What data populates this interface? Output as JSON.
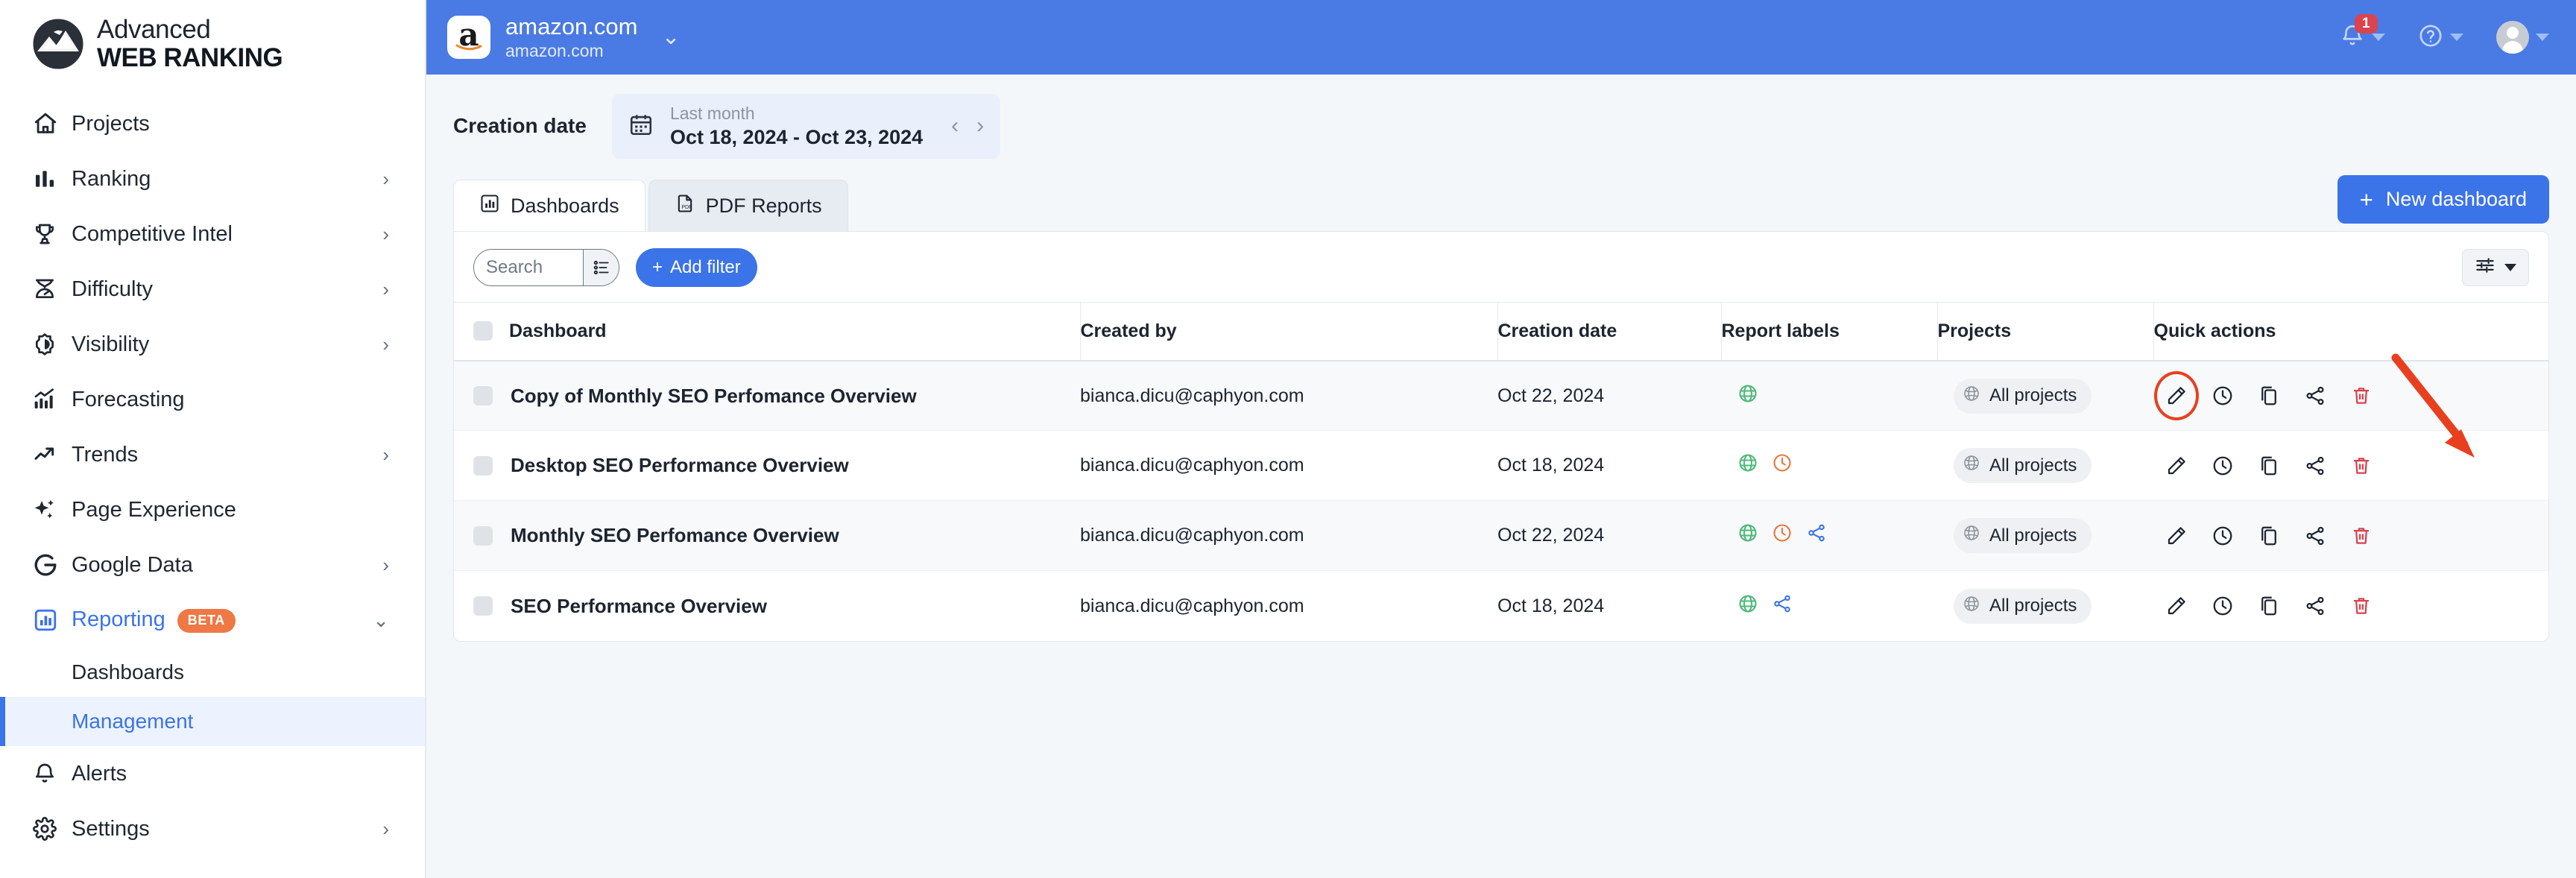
{
  "brand": {
    "line1": "Advanced",
    "line2": "WEB RANKING",
    "logo_icon": "globe-mountain-logo"
  },
  "sidebar": {
    "items": [
      {
        "label": "Projects",
        "icon": "home-icon",
        "chevron": "",
        "active": false
      },
      {
        "label": "Ranking",
        "icon": "bar-chart-icon",
        "chevron": "›",
        "active": false
      },
      {
        "label": "Competitive Intel",
        "icon": "trophy-icon",
        "chevron": "›",
        "active": false
      },
      {
        "label": "Difficulty",
        "icon": "hourglass-gauge-icon",
        "chevron": "›",
        "active": false
      },
      {
        "label": "Visibility",
        "icon": "brightness-icon",
        "chevron": "›",
        "active": false
      },
      {
        "label": "Forecasting",
        "icon": "forecast-chart-icon",
        "chevron": "",
        "active": false
      },
      {
        "label": "Trends",
        "icon": "trend-arrow-icon",
        "chevron": "›",
        "active": false
      },
      {
        "label": "Page Experience",
        "icon": "sparkles-icon",
        "chevron": "",
        "active": false
      },
      {
        "label": "Google Data",
        "icon": "google-g-icon",
        "chevron": "›",
        "active": false
      },
      {
        "label": "Reporting",
        "icon": "report-chart-icon",
        "chevron": "⌄",
        "active": true,
        "badge": "BETA"
      }
    ],
    "subitems": [
      {
        "label": "Dashboards",
        "selected": false
      },
      {
        "label": "Management",
        "selected": true
      }
    ],
    "tail": [
      {
        "label": "Alerts",
        "icon": "bell-icon",
        "chevron": ""
      },
      {
        "label": "Settings",
        "icon": "gear-icon",
        "chevron": "›"
      }
    ]
  },
  "topbar": {
    "site_name": "amazon.com",
    "site_domain": "amazon.com",
    "favicon_letter": "a",
    "chevron": "⌄",
    "notifications_count": "1",
    "notification_icon": "bell-icon",
    "help_icon": "question-circle-icon",
    "avatar_icon": "user-avatar-icon",
    "accent": "#4a7ae4"
  },
  "datebar": {
    "label": "Creation date",
    "preset": "Last month",
    "range": "Oct 18, 2024 - Oct 23, 2024",
    "calendar_icon": "calendar-icon",
    "prev": "‹",
    "next": "›"
  },
  "tabs": [
    {
      "label": "Dashboards",
      "icon": "bar-chart-icon",
      "active": true
    },
    {
      "label": "PDF Reports",
      "icon": "pdf-file-icon",
      "active": false
    }
  ],
  "actions": {
    "new_dashboard": "New dashboard",
    "new_dashboard_plus": "+",
    "add_filter": "Add filter",
    "add_filter_plus": "+",
    "settings_icon": "sliders-icon"
  },
  "search": {
    "value": "",
    "placeholder": "Search",
    "list_icon": "list-settings-icon"
  },
  "table": {
    "columns": [
      "Dashboard",
      "Created by",
      "Creation date",
      "Report labels",
      "Projects",
      "Quick actions"
    ],
    "rows": [
      {
        "name": "Copy of Monthly SEO Perfomance Overview",
        "created_by": "bianca.dicu@caphyon.com",
        "creation_date": "Oct 22, 2024",
        "labels": [
          "globe"
        ],
        "project": "All projects",
        "actions": [
          "edit",
          "schedule",
          "duplicate",
          "share",
          "delete"
        ],
        "highlighted_action": "edit"
      },
      {
        "name": "Desktop SEO Performance Overview",
        "created_by": "bianca.dicu@caphyon.com",
        "creation_date": "Oct 18, 2024",
        "labels": [
          "globe",
          "clock"
        ],
        "project": "All projects",
        "actions": [
          "edit",
          "schedule",
          "duplicate",
          "share",
          "delete"
        ],
        "highlighted_action": ""
      },
      {
        "name": "Monthly SEO Perfomance Overview",
        "created_by": "bianca.dicu@caphyon.com",
        "creation_date": "Oct 22, 2024",
        "labels": [
          "globe",
          "clock",
          "share"
        ],
        "project": "All projects",
        "actions": [
          "edit",
          "schedule",
          "duplicate",
          "share",
          "delete"
        ],
        "highlighted_action": ""
      },
      {
        "name": "SEO Performance Overview",
        "created_by": "bianca.dicu@caphyon.com",
        "creation_date": "Oct 18, 2024",
        "labels": [
          "globe",
          "share"
        ],
        "project": "All projects",
        "actions": [
          "edit",
          "schedule",
          "duplicate",
          "share",
          "delete"
        ],
        "highlighted_action": ""
      }
    ],
    "project_badge_icon": "globe-grey-icon"
  },
  "annotation": {
    "arrow_color": "#e8401f",
    "circle_color": "#e8401f"
  },
  "colors": {
    "accent_blue": "#3b73e8",
    "header_blue": "#4a7ae4",
    "label_green": "#4fb87a",
    "label_orange": "#e8763c",
    "label_blue": "#3b73e8",
    "delete_red": "#d9434f",
    "beta_orange": "#ef7845"
  }
}
